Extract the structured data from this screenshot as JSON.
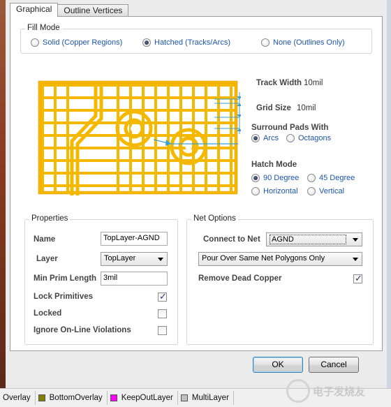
{
  "tabs": [
    "Graphical",
    "Outline Vertices"
  ],
  "fill_mode": {
    "title": "Fill Mode",
    "options": [
      "Solid (Copper Regions)",
      "Hatched (Tracks/Arcs)",
      "None (Outlines Only)"
    ],
    "selected": "Hatched (Tracks/Arcs)"
  },
  "hatch_params": {
    "track_width_label": "Track Width",
    "track_width_value": "10mil",
    "grid_size_label": "Grid Size",
    "grid_size_value": "10mil",
    "surround_title": "Surround Pads With",
    "surround_options": [
      "Arcs",
      "Octagons"
    ],
    "surround_selected": "Arcs",
    "hatch_title": "Hatch Mode",
    "hatch_options": [
      "90 Degree",
      "45 Degree",
      "Horizontal",
      "Vertical"
    ],
    "hatch_selected": "90 Degree"
  },
  "properties": {
    "title": "Properties",
    "name_label": "Name",
    "name_value": "TopLayer-AGND",
    "layer_label": "Layer",
    "layer_value": "TopLayer",
    "min_prim_label": "Min Prim Length",
    "min_prim_value": "3mil",
    "lock_primitives_label": "Lock Primitives",
    "lock_primitives_checked": true,
    "locked_label": "Locked",
    "locked_checked": false,
    "ignore_label": "Ignore On-Line Violations",
    "ignore_checked": false
  },
  "net_options": {
    "title": "Net Options",
    "connect_label": "Connect to Net",
    "connect_value": "AGND",
    "pour_value": "Pour Over Same Net Polygons Only",
    "remove_dead_label": "Remove Dead Copper",
    "remove_dead_checked": true
  },
  "buttons": {
    "ok": "OK",
    "cancel": "Cancel"
  },
  "layer_tabs": [
    {
      "label": "Overlay",
      "color": ""
    },
    {
      "label": "BottomOverlay",
      "color": "#7f7f00"
    },
    {
      "label": "KeepOutLayer",
      "color": "#ff00ff"
    },
    {
      "label": "MultiLayer",
      "color": "#c0c0c0"
    }
  ],
  "watermark": "电子发烧友",
  "colors": {
    "copper": "#f5b800",
    "accent_blue": "#1c56a8",
    "dimension": "#3aa0d0"
  }
}
